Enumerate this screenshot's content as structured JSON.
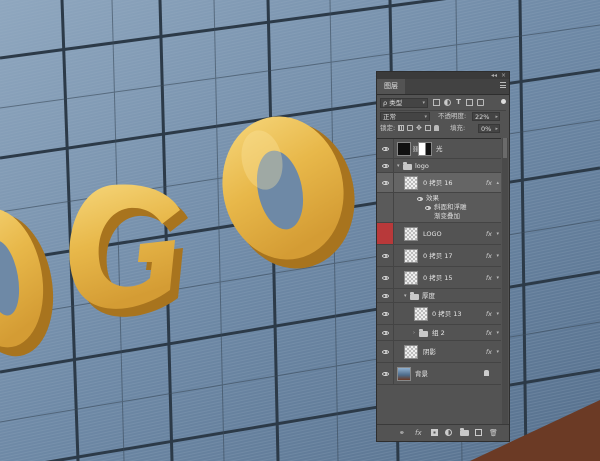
{
  "panel": {
    "collapse_glyph": "◂◂",
    "close_glyph": "×",
    "tab_label": "图层",
    "filter": {
      "kind_label": "ρ 类型",
      "icons": [
        "image-filter-icon",
        "adjustment-filter-icon",
        "type-filter-icon",
        "shape-filter-icon",
        "smart-object-filter-icon"
      ]
    },
    "blend_mode": "正常",
    "opacity_label": "不透明度:",
    "opacity_value": "22%",
    "lock_label": "锁定:",
    "fill_label": "填充:",
    "fill_value": "0%",
    "layers": [
      {
        "name": "光",
        "type": "layer-with-mask"
      },
      {
        "name": "logo",
        "type": "group",
        "expanded": true
      },
      {
        "name": "0 拷贝 16",
        "type": "layer",
        "fx": "fx",
        "selected": true
      },
      {
        "effects_title": "效果",
        "effects": [
          "斜面和浮雕",
          "渐变叠加"
        ]
      },
      {
        "name": "LOGO",
        "type": "layer",
        "fx": "fx",
        "eye_red": true
      },
      {
        "name": "0 拷贝 17",
        "type": "layer",
        "fx": "fx"
      },
      {
        "name": "0 拷贝 15",
        "type": "layer",
        "fx": "fx"
      },
      {
        "name": "厚度",
        "type": "group",
        "expanded": true
      },
      {
        "name": "0 拷贝 13",
        "type": "layer",
        "fx": "fx"
      },
      {
        "name": "组 2",
        "type": "group",
        "expanded": false,
        "fx": "fx"
      },
      {
        "name": "阴影",
        "type": "layer",
        "fx": "fx"
      },
      {
        "name": "背景",
        "type": "background",
        "locked": true
      }
    ],
    "bottom_icons": [
      "link-icon",
      "fx-icon",
      "mask-icon",
      "adjustment-icon",
      "folder-icon",
      "new-layer-icon",
      "trash-icon"
    ],
    "bottom_fx": "fx"
  },
  "canvas": {
    "letters": [
      "O",
      "G",
      "O"
    ],
    "colors": {
      "glass": "#6f8aa8",
      "gold": "#e8b84a",
      "gold_dark": "#a8741e",
      "frame": "#2c3a48"
    }
  }
}
